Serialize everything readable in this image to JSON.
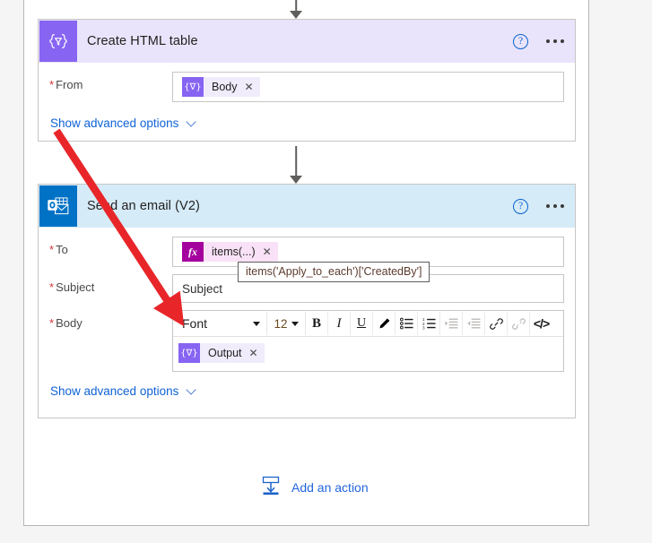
{
  "flow": {
    "cards": [
      {
        "id": "create-html-table",
        "title": "Create HTML table",
        "icon": "flow-data-operation-icon",
        "help_label": "?",
        "rows": [
          {
            "label": "From",
            "required_marker": "*",
            "token": {
              "icon_glyph": "{∇}",
              "text": "Body",
              "remove_glyph": "✕",
              "kind": "flow"
            }
          }
        ],
        "advanced_label": "Show advanced options"
      },
      {
        "id": "send-an-email-v2",
        "title": "Send an email (V2)",
        "icon": "outlook-icon",
        "help_label": "?",
        "rows": [
          {
            "label": "To",
            "required_marker": "*",
            "token": {
              "icon_glyph": "fx",
              "text": "items(...)",
              "remove_glyph": "✕",
              "kind": "fx"
            }
          },
          {
            "label": "Subject",
            "required_marker": "*",
            "placeholder": "Subject"
          },
          {
            "label": "Body",
            "required_marker": "*",
            "token": {
              "icon_glyph": "{∇}",
              "text": "Output",
              "remove_glyph": "✕",
              "kind": "flow"
            }
          }
        ],
        "advanced_label": "Show advanced options"
      }
    ],
    "editor_toolbar": {
      "font_value": "Font",
      "size_value": "12",
      "buttons": [
        {
          "name": "bold-icon",
          "glyph": "B",
          "disabled": false
        },
        {
          "name": "italic-icon",
          "glyph": "I",
          "disabled": false
        },
        {
          "name": "underline-icon",
          "glyph": "U",
          "disabled": false
        },
        {
          "name": "text-color-icon",
          "glyph": "✏",
          "disabled": false
        },
        {
          "name": "bulleted-list-icon",
          "glyph": "",
          "disabled": false
        },
        {
          "name": "numbered-list-icon",
          "glyph": "",
          "disabled": false
        },
        {
          "name": "indent-icon",
          "glyph": "",
          "disabled": true
        },
        {
          "name": "outdent-icon",
          "glyph": "",
          "disabled": true
        },
        {
          "name": "link-icon",
          "glyph": "🔗",
          "disabled": false
        },
        {
          "name": "unlink-icon",
          "glyph": "🔗",
          "disabled": true
        },
        {
          "name": "code-view-icon",
          "glyph": "</>",
          "disabled": false
        }
      ]
    },
    "tooltip": {
      "text": "items('Apply_to_each')['CreatedBy']"
    },
    "add_action": {
      "label": "Add an action",
      "icon": "insert-action-icon"
    }
  },
  "colors": {
    "flow_purple": "#8764f2",
    "outlook_blue": "#0072c6",
    "fx_magenta": "#a4009e",
    "link_blue": "#0f62d6",
    "required_red": "#d13438",
    "annotation_red": "#e8262a",
    "header_purple_bg": "#e9e4fb",
    "header_blue_bg": "#d6ebf8"
  }
}
